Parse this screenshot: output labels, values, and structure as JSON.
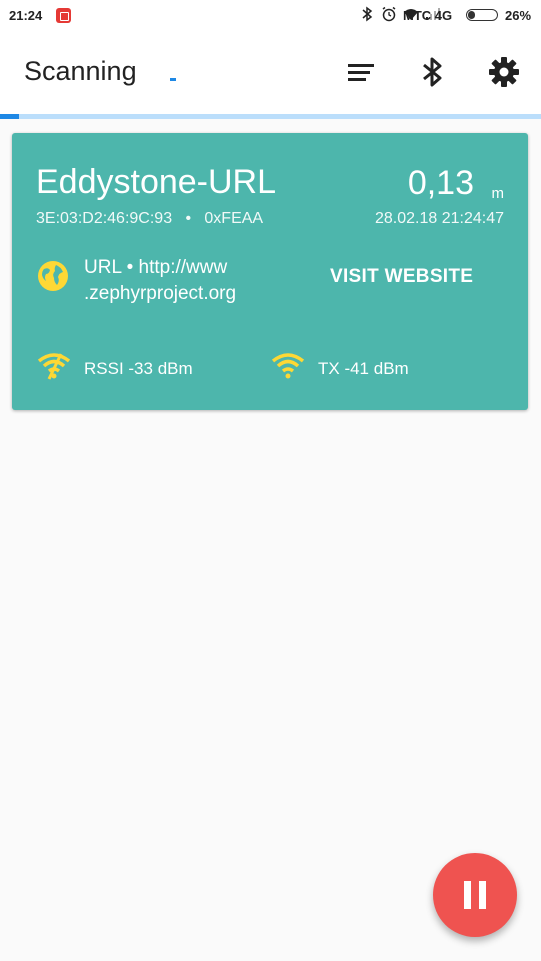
{
  "status_bar": {
    "time": "21:24",
    "carrier": "МТС 4G",
    "battery": "26%",
    "battery_level": 0.26,
    "icons": [
      "notification-icon",
      "bluetooth-icon",
      "alarm-icon",
      "wifi-icon",
      "signal-icon"
    ]
  },
  "app_bar": {
    "title": "Scanning",
    "actions": [
      "sort-icon",
      "bluetooth-icon",
      "settings-icon"
    ],
    "progress": 0.035
  },
  "beacon": {
    "name": "Eddystone-URL",
    "mac": "3E:03:D2:46:9C:93",
    "separator": "•",
    "service": "0xFEAA",
    "distance": "0,13",
    "distance_unit": "m",
    "timestamp": "28.02.18 21:24:47",
    "url_line1": "URL • http://www",
    "url_line2": ".zephyrproject.org",
    "visit_label": "VISIT WEBSITE",
    "rssi": "RSSI -33 dBm",
    "tx": "TX -41 dBm"
  },
  "colors": {
    "card": "#4db6ac",
    "accent": "#1e88e5",
    "fab": "#ef5350",
    "icon_yellow": "#fdd835"
  },
  "fab": {
    "icon": "pause-icon"
  }
}
